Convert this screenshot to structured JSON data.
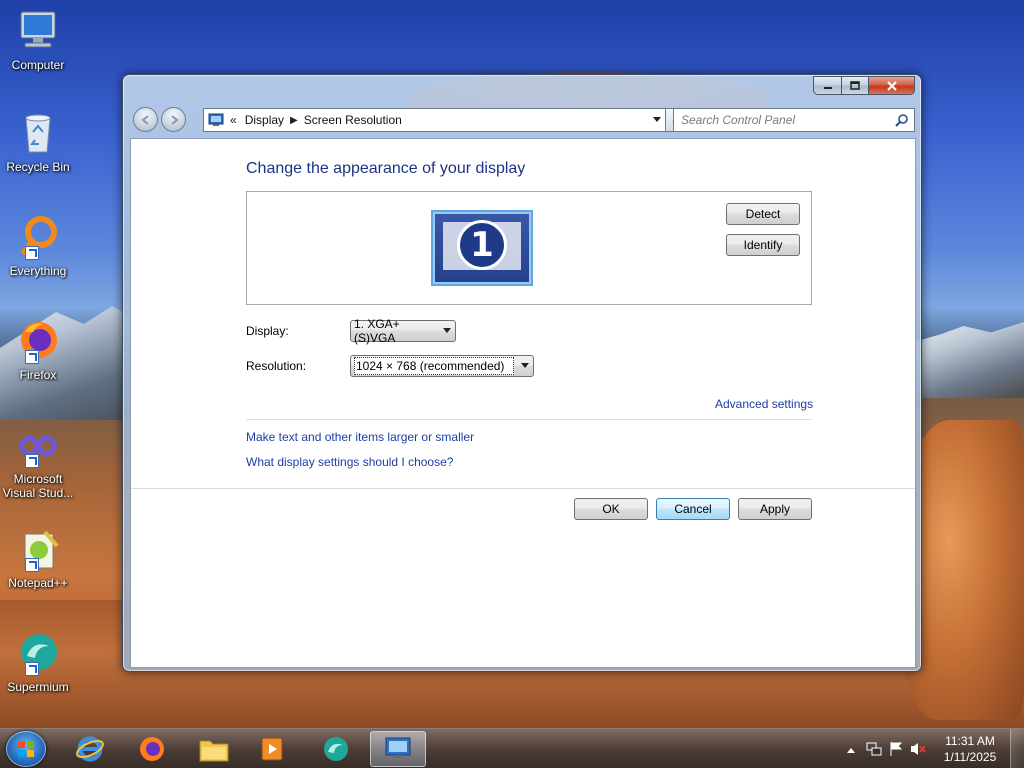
{
  "desktop": {
    "icons": [
      {
        "label": "Computer"
      },
      {
        "label": "Recycle Bin"
      },
      {
        "label": "Everything"
      },
      {
        "label": "Firefox"
      },
      {
        "label": "Microsoft Visual Stud..."
      },
      {
        "label": "Notepad++"
      },
      {
        "label": "Supermium"
      }
    ]
  },
  "window": {
    "breadcrumb": {
      "overflow": "«",
      "items": [
        "Display",
        "Screen Resolution"
      ]
    },
    "search_placeholder": "Search Control Panel",
    "heading": "Change the appearance of your display",
    "monitor_number": "1",
    "detect_label": "Detect",
    "identify_label": "Identify",
    "display_label": "Display:",
    "display_value": "1. XGA+(S)VGA",
    "resolution_label": "Resolution:",
    "resolution_value": "1024 × 768 (recommended)",
    "advanced_link": "Advanced settings",
    "links": [
      "Make text and other items larger or smaller",
      "What display settings should I choose?"
    ],
    "ok_label": "OK",
    "cancel_label": "Cancel",
    "apply_label": "Apply"
  },
  "taskbar": {
    "items": [
      "start-button",
      "internet-explorer-icon",
      "firefox-icon",
      "file-explorer-icon",
      "media-player-icon",
      "supermium-icon",
      "display-settings-icon"
    ],
    "clock": {
      "time": "11:31 AM",
      "date": "1/11/2025"
    },
    "tray_icons": [
      "show-hidden-icons",
      "network-icon",
      "action-center-flag-icon",
      "volume-muted-icon"
    ]
  },
  "colors": {
    "heading": "#1e3287",
    "link": "#1e3ea8",
    "window_glass": "#bcd0ea"
  }
}
